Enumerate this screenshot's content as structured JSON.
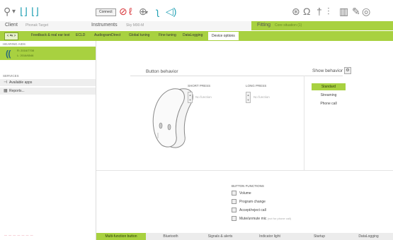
{
  "toolbar": {
    "connect_label": "Connect",
    "icons": [
      "pin-icon",
      "audiogram-icon",
      "ear-icon",
      "hearing-instrument-icon",
      "tinnitus-icon",
      "sound-icon",
      "speech-test-icon",
      "acoustic-icon",
      "tuning-fork-icon",
      "equalizer-icon",
      "bar-chart-icon",
      "wrench-icon",
      "help-icon"
    ]
  },
  "info": {
    "client_label": "Client",
    "client_value": "Phonak Target",
    "instruments_label": "Instruments",
    "instruments_value": "Sky M90-M",
    "fitting_label": "Fitting",
    "fitting_value": "Core situation (1)"
  },
  "tabs": {
    "toggle_label": "< ⇆ >",
    "items": [
      {
        "label": "Feedback & real ear test",
        "active": false
      },
      {
        "label": "ECLD",
        "active": false
      },
      {
        "label": "AudiogramDirect",
        "active": false
      },
      {
        "label": "Global tuning",
        "active": false
      },
      {
        "label": "Fine tuning",
        "active": false
      },
      {
        "label": "DataLogging",
        "active": false
      },
      {
        "label": "Device options",
        "active": true
      }
    ]
  },
  "left": {
    "hearing_aids_header": "HEARING AIDS",
    "ha_line1": "R: 2016/7708",
    "ha_line2": "L: 2016/6546",
    "services_header": "SERVICES",
    "services": [
      {
        "label": "Available apps",
        "icon": "apps-icon"
      },
      {
        "label": "Reports...",
        "icon": "reports-icon"
      }
    ],
    "bottom_note": "— — — — — — —"
  },
  "main": {
    "title": "Button behavior",
    "show_behavior_label": "Show behavior",
    "behaviors": [
      {
        "label": "Standard",
        "selected": true
      },
      {
        "label": "Streaming",
        "selected": false
      },
      {
        "label": "Phone call",
        "selected": false
      }
    ],
    "short_press_label": "SHORT PRESS",
    "short_press_value": "No function",
    "long_press_label": "LONG PRESS",
    "long_press_value": "No function",
    "button_functions_header": "BUTTON FUNCTIONS",
    "button_functions": [
      {
        "label": "Volume",
        "note": ""
      },
      {
        "label": "Program change",
        "note": ""
      },
      {
        "label": "Accept/reject call",
        "note": ""
      },
      {
        "label": "Mute/unmute mic",
        "note": "(not for phone call)"
      }
    ]
  },
  "bottom_tabs": [
    {
      "label": "Multi-function button",
      "active": true
    },
    {
      "label": "Bluetooth",
      "active": false
    },
    {
      "label": "Signals & alerts",
      "active": false
    },
    {
      "label": "Indicator light",
      "active": false
    },
    {
      "label": "Startup",
      "active": false
    },
    {
      "label": "DataLogging",
      "active": false
    }
  ],
  "colors": {
    "accent_green": "#a8d140",
    "teal": "#25a2b5",
    "red": "#d8353a"
  }
}
